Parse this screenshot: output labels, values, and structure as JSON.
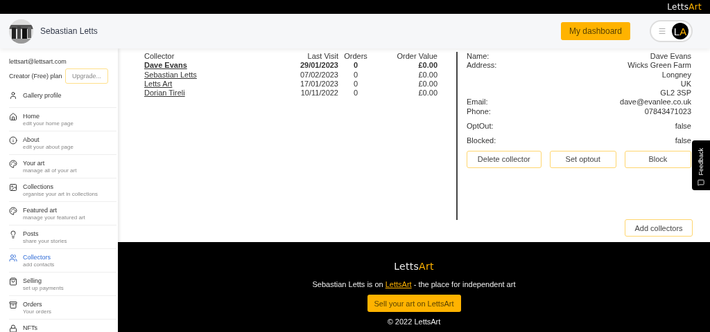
{
  "top_logo": [
    {
      "text": "Letts",
      "accent": false
    },
    {
      "text": "Art",
      "accent": true
    }
  ],
  "header": {
    "name": "Sebastian Letts",
    "dashboard_button": "My dashboard",
    "initials": [
      {
        "text": "L",
        "accent": false
      },
      {
        "text": "A",
        "accent": true
      }
    ]
  },
  "sidebar": {
    "email": "lettsart@lettsart.com",
    "plan": "Creator (Free) plan",
    "upgrade_button": "Upgrade...",
    "profile_link": "Gallery profile",
    "items": [
      {
        "title": "Home",
        "subtitle": "edit your home page",
        "selected": false
      },
      {
        "title": "About",
        "subtitle": "edit your about page",
        "selected": false
      },
      {
        "title": "Your art",
        "subtitle": "manage all of your art",
        "selected": false
      },
      {
        "title": "Collections",
        "subtitle": "organise your art in collections",
        "selected": false
      },
      {
        "title": "Featured art",
        "subtitle": "manage your featured art",
        "selected": false
      },
      {
        "title": "Posts",
        "subtitle": "share your stories",
        "selected": false
      },
      {
        "title": "Collectors",
        "subtitle": "add contacts",
        "selected": true
      },
      {
        "title": "Selling",
        "subtitle": "set up payments",
        "selected": false
      },
      {
        "title": "Orders",
        "subtitle": "Your orders",
        "selected": false
      },
      {
        "title": "NFTs",
        "selected": false
      }
    ]
  },
  "table": {
    "columns": [
      "Collector",
      "Last Visit",
      "Orders",
      "Order Value"
    ],
    "rows": [
      {
        "cells": [
          "Dave Evans",
          "29/01/2023",
          "0",
          "£0.00"
        ],
        "selected": true
      },
      {
        "cells": [
          "Sebastian Letts",
          "07/02/2023",
          "0",
          "£0.00"
        ],
        "selected": false
      },
      {
        "cells": [
          "Letts Art",
          "17/01/2023",
          "0",
          "£0.00"
        ],
        "selected": false
      },
      {
        "cells": [
          "Dorian Tireli",
          "10/11/2022",
          "0",
          "£0.00"
        ],
        "selected": false
      }
    ]
  },
  "details": {
    "fields": [
      {
        "label": "Name:",
        "lines": [
          "Dave Evans"
        ]
      },
      {
        "label": "Address:",
        "lines": [
          "Wicks Green Farm",
          "Longney",
          "UK",
          "GL2 3SP"
        ]
      },
      {
        "label": "Email:",
        "lines": [
          "dave@evanlee.co.uk"
        ]
      },
      {
        "label": "Phone:",
        "lines": [
          "07843471023"
        ]
      },
      {
        "label": "OptOut:",
        "lines": [
          "false"
        ]
      },
      {
        "label": "Blocked:",
        "lines": [
          "false"
        ]
      }
    ],
    "buttons": [
      "Delete collector",
      "Set optout",
      "Block"
    ]
  },
  "add_button": "Add collectors",
  "feedback_tab": "Feedback",
  "footer": {
    "logo": [
      {
        "text": "Letts",
        "accent": false
      },
      {
        "text": "Art",
        "accent": true
      }
    ],
    "before": "Sebastian Letts is on ",
    "link": "LettsArt",
    "after": " - the place for independent art",
    "cta": "Sell your art on LettsArt",
    "copyright": "© 2022 LettsArt"
  }
}
